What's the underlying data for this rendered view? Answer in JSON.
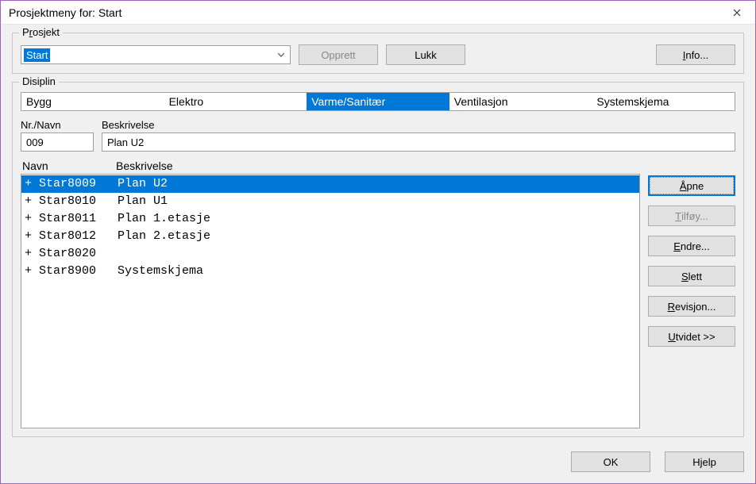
{
  "window": {
    "title": "Prosjektmeny for: Start"
  },
  "prosjekt": {
    "legend": {
      "pre": "P",
      "u": "r",
      "post": "osjekt"
    },
    "value": "Start",
    "opprett": "Opprett",
    "lukk": "Lukk",
    "info": {
      "pre": "",
      "u": "I",
      "post": "nfo..."
    }
  },
  "disiplin": {
    "legend": "Disiplin",
    "tabs": [
      {
        "label": "Bygg",
        "selected": false
      },
      {
        "label": "Elektro",
        "selected": false
      },
      {
        "label": "Varme/Sanitær",
        "selected": true
      },
      {
        "label": "Ventilasjon",
        "selected": false
      },
      {
        "label": "Systemskjema",
        "selected": false
      }
    ],
    "nr_label": "Nr./Navn",
    "besk_label": "Beskrivelse",
    "nr_val": "009",
    "besk_val": "Plan U2",
    "list_navn_hdr": "Navn",
    "list_besk_hdr": "Beskrivelse",
    "items": [
      {
        "navn": "Star8009",
        "besk": "Plan U2",
        "selected": true
      },
      {
        "navn": "Star8010",
        "besk": "Plan U1",
        "selected": false
      },
      {
        "navn": "Star8011",
        "besk": "Plan 1.etasje",
        "selected": false
      },
      {
        "navn": "Star8012",
        "besk": "Plan 2.etasje",
        "selected": false
      },
      {
        "navn": "Star8020",
        "besk": "",
        "selected": false
      },
      {
        "navn": "Star8900",
        "besk": "Systemskjema",
        "selected": false
      }
    ],
    "buttons": {
      "apne": {
        "pre": "",
        "u": "Å",
        "post": "pne"
      },
      "tilfoy": {
        "pre": "",
        "u": "T",
        "post": "ilføy...",
        "disabled": true
      },
      "endre": {
        "pre": "",
        "u": "E",
        "post": "ndre..."
      },
      "slett": {
        "pre": "",
        "u": "S",
        "post": "lett"
      },
      "revisjon": {
        "pre": "",
        "u": "R",
        "post": "evisjon..."
      },
      "utvidet": {
        "pre": "",
        "u": "U",
        "post": "tvidet >>"
      }
    }
  },
  "footer": {
    "ok": "OK",
    "hjelp": "Hjelp"
  }
}
